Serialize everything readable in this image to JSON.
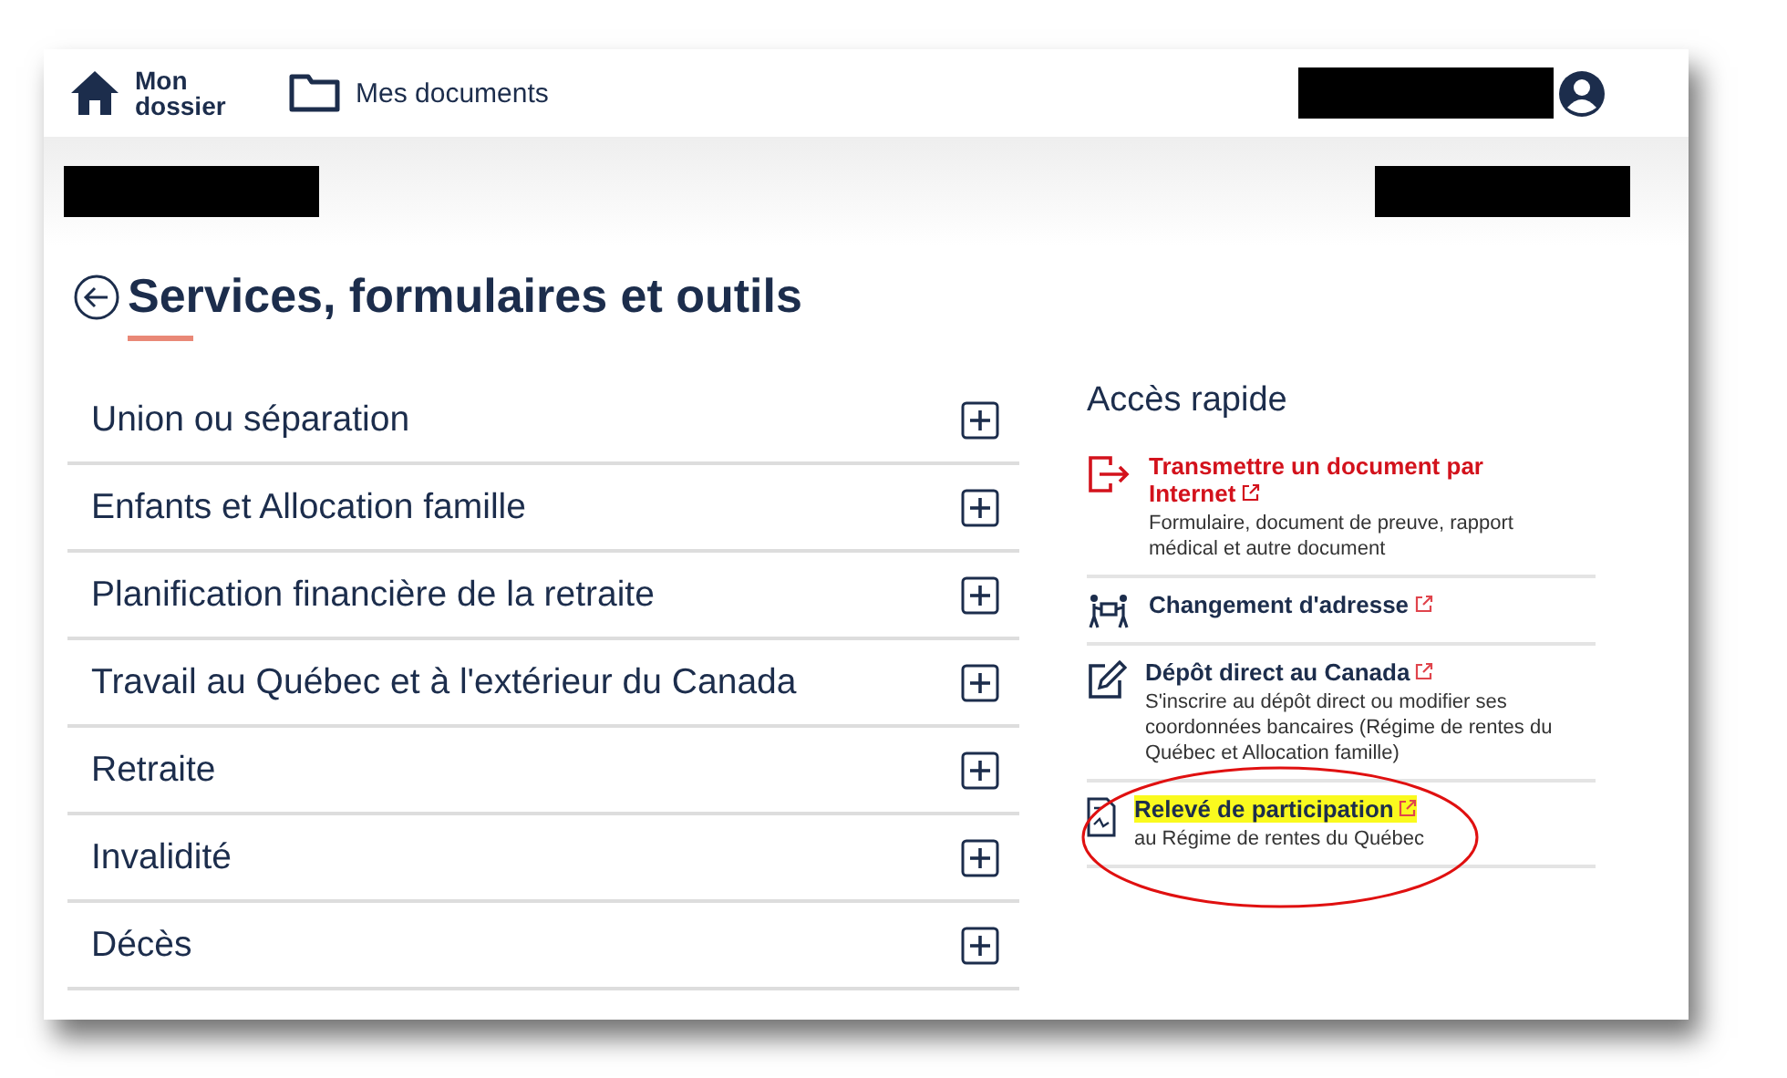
{
  "header": {
    "home_label": "Mon dossier",
    "documents_label": "Mes documents"
  },
  "page": {
    "title": "Services, formulaires et outils"
  },
  "accordion": [
    {
      "label": "Union ou séparation",
      "expanded": false
    },
    {
      "label": "Enfants et Allocation famille",
      "expanded": false
    },
    {
      "label": "Planification financière de la retraite",
      "expanded": false
    },
    {
      "label": "Travail au Québec et à l'extérieur du Canada",
      "expanded": false
    },
    {
      "label": "Retraite",
      "expanded": false
    },
    {
      "label": "Invalidité",
      "expanded": false
    },
    {
      "label": "Décès",
      "expanded": false
    }
  ],
  "quick_access": {
    "title": "Accès rapide",
    "items": [
      {
        "kind": "upload",
        "title": "Transmettre un document par Internet",
        "description": "Formulaire, document de preuve, rapport médical et autre document",
        "emphasis": true,
        "highlighted": false,
        "circled": false
      },
      {
        "kind": "moving",
        "title": "Changement d'adresse",
        "emphasis": false,
        "highlighted": false,
        "circled": false
      },
      {
        "kind": "edit",
        "title": "Dépôt direct au Canada",
        "description": "S'inscrire au dépôt direct ou modifier ses coordonnées bancaires (Régime de rentes du Québec et Allocation famille)",
        "emphasis": false,
        "highlighted": false,
        "circled": false
      },
      {
        "kind": "document",
        "title": "Relevé de participation",
        "description": "au Régime de rentes du Québec",
        "emphasis": false,
        "highlighted": true,
        "circled": true
      }
    ]
  }
}
